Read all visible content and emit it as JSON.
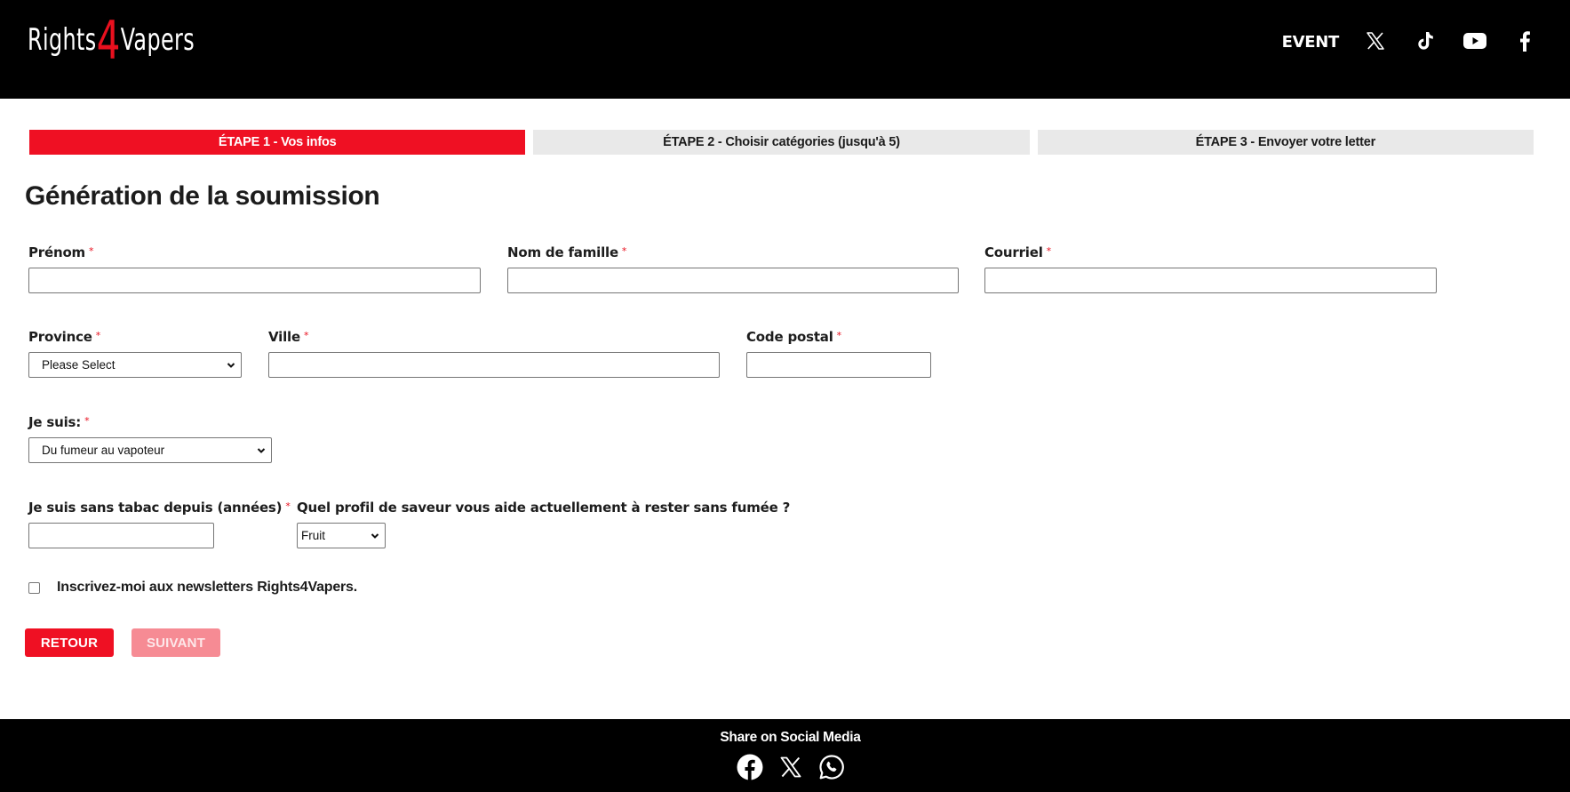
{
  "header": {
    "logo": {
      "part1": "Rights",
      "part2": "4",
      "part3": "Vapers"
    },
    "nav": {
      "event_label": "EVENT",
      "icons": [
        "x-twitter-icon",
        "tiktok-icon",
        "youtube-icon",
        "facebook-icon"
      ]
    }
  },
  "steps": [
    {
      "label": "ÉTAPE 1 - Vos infos",
      "active": true
    },
    {
      "label": "ÉTAPE 2 - Choisir catégories (jusqu'à 5)",
      "active": false
    },
    {
      "label": "ÉTAPE 3 - Envoyer votre letter",
      "active": false
    }
  ],
  "form": {
    "title": "Génération de la soumission",
    "required_mark": "*",
    "first_name": {
      "label": "Prénom",
      "value": ""
    },
    "last_name": {
      "label": "Nom de famille",
      "value": ""
    },
    "email": {
      "label": "Courriel",
      "value": ""
    },
    "province": {
      "label": "Province",
      "selected": "Please Select"
    },
    "city": {
      "label": "Ville",
      "value": ""
    },
    "postal_code": {
      "label": "Code postal",
      "value": ""
    },
    "i_am": {
      "label": "Je suis:",
      "selected": "Du fumeur au vapoteur"
    },
    "smoke_free_years": {
      "label": "Je suis sans tabac depuis (années)",
      "value": ""
    },
    "flavor_profile": {
      "label": "Quel profil de saveur vous aide actuellement à rester sans fumée ?",
      "selected": "Fruit"
    },
    "newsletter": {
      "label": "Inscrivez-moi aux newsletters Rights4Vapers.",
      "checked": false
    },
    "back_label": "RETOUR",
    "next_label": "SUIVANT"
  },
  "footer": {
    "share_title": "Share on Social Media",
    "icons": [
      "facebook-icon",
      "x-twitter-icon",
      "whatsapp-icon"
    ]
  },
  "colors": {
    "brand_red": "#ef1023",
    "disabled_red": "#f68b94",
    "inactive_step": "#e9e9e9",
    "header_bg": "#000000"
  }
}
